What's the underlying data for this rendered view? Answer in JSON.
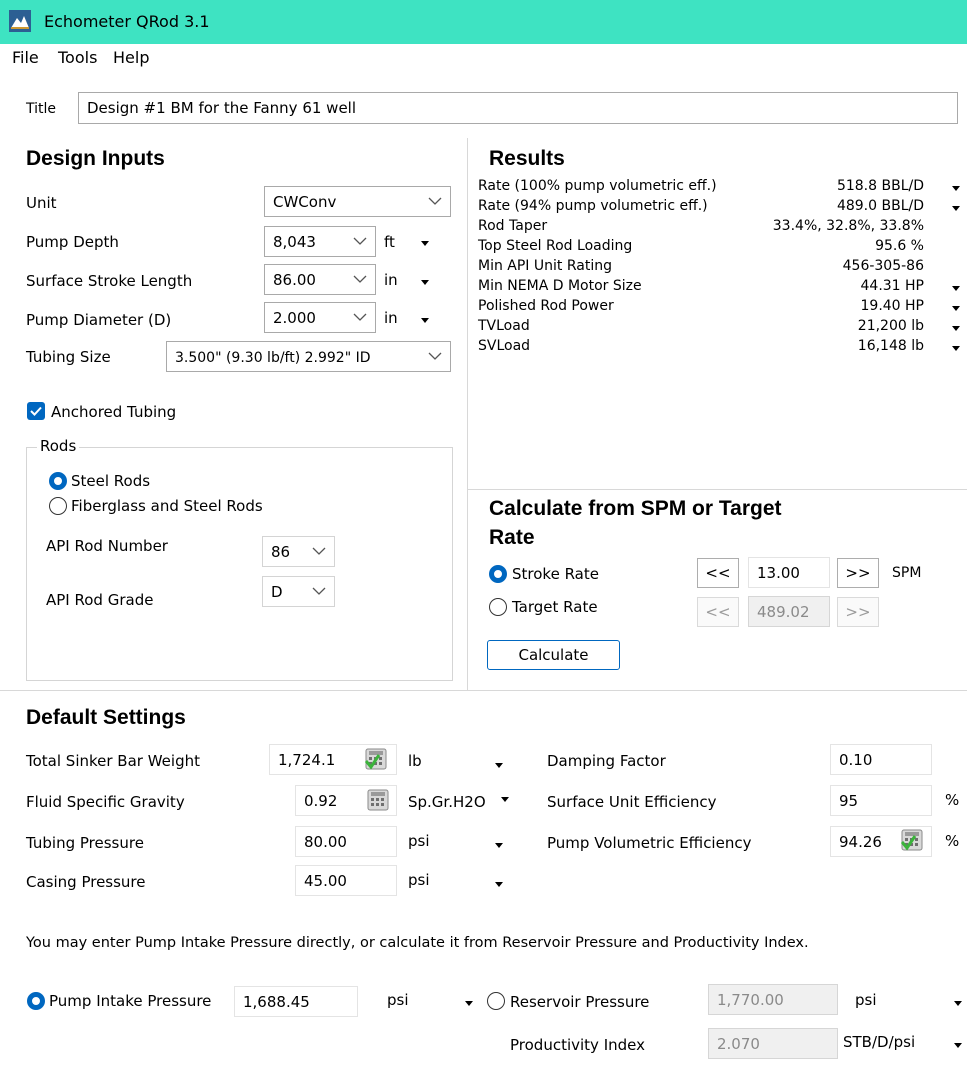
{
  "window": {
    "title": "Echometer QRod 3.1"
  },
  "menu": [
    "File",
    "Tools",
    "Help"
  ],
  "title_field": {
    "label": "Title",
    "value": "Design #1 BM for the Fanny 61 well"
  },
  "design_inputs": {
    "heading": "Design Inputs",
    "unit": {
      "label": "Unit",
      "value": "CWConv"
    },
    "pump_depth": {
      "label": "Pump Depth",
      "value": "8,043",
      "unit": "ft"
    },
    "stroke_length": {
      "label": "Surface Stroke Length",
      "value": "86.00",
      "unit": "in"
    },
    "pump_diameter": {
      "label": "Pump Diameter (D)",
      "value": "2.000",
      "unit": "in"
    },
    "tubing_size": {
      "label": "Tubing Size",
      "value": "3.500\" (9.30 lb/ft) 2.992\" ID"
    },
    "anchored_tubing": {
      "label": "Anchored Tubing",
      "checked": true
    },
    "rods": {
      "group_label": "Rods",
      "steel": "Steel Rods",
      "fiberglass": "Fiberglass and Steel Rods",
      "selected": "steel",
      "api_rod_number": {
        "label": "API Rod Number",
        "value": "86"
      },
      "api_rod_grade": {
        "label": "API Rod Grade",
        "value": "D"
      }
    }
  },
  "results": {
    "heading": "Results",
    "rows": [
      {
        "label": "Rate (100% pump volumetric eff.)",
        "value": "518.8 BBL/D",
        "dropdown": true
      },
      {
        "label": "Rate (94% pump volumetric eff.)",
        "value": "489.0 BBL/D",
        "dropdown": true
      },
      {
        "label": "Rod Taper",
        "value": "33.4%, 32.8%, 33.8%",
        "dropdown": false
      },
      {
        "label": "Top Steel Rod Loading",
        "value": "95.6 %",
        "dropdown": false
      },
      {
        "label": "Min API Unit Rating",
        "value": "456-305-86",
        "dropdown": false
      },
      {
        "label": "Min NEMA D Motor Size",
        "value": "44.31 HP",
        "dropdown": true
      },
      {
        "label": "Polished Rod Power",
        "value": "19.40 HP",
        "dropdown": true
      },
      {
        "label": "TVLoad",
        "value": "21,200 lb",
        "dropdown": true
      },
      {
        "label": "SVLoad",
        "value": "16,148 lb",
        "dropdown": true
      }
    ]
  },
  "calculate": {
    "heading_line1": "Calculate from SPM or Target",
    "heading_line2": "Rate",
    "stroke_rate": {
      "label": "Stroke Rate",
      "value": "13.00",
      "unit": "SPM"
    },
    "target_rate": {
      "label": "Target Rate",
      "value": "489.02"
    },
    "selected": "stroke_rate",
    "dec_label": "<<",
    "inc_label": ">>",
    "button": "Calculate"
  },
  "defaults": {
    "heading": "Default Settings",
    "sinker_bar": {
      "label": "Total Sinker Bar Weight",
      "value": "1,724.1",
      "unit": "lb"
    },
    "fluid_sg": {
      "label": "Fluid Specific Gravity",
      "value": "0.92",
      "unit": "Sp.Gr.H2O"
    },
    "tubing_pressure": {
      "label": "Tubing Pressure",
      "value": "80.00",
      "unit": "psi"
    },
    "casing_pressure": {
      "label": "Casing Pressure",
      "value": "45.00",
      "unit": "psi"
    },
    "damping": {
      "label": "Damping Factor",
      "value": "0.10"
    },
    "surface_eff": {
      "label": "Surface Unit Efficiency",
      "value": "95",
      "unit": "%"
    },
    "pump_vol_eff": {
      "label": "Pump Volumetric Efficiency",
      "value": "94.26",
      "unit": "%"
    }
  },
  "intake": {
    "note": "You may enter Pump Intake Pressure directly, or calculate it from Reservoir Pressure and Productivity Index.",
    "pip": {
      "label": "Pump Intake Pressure",
      "value": "1,688.45",
      "unit": "psi"
    },
    "reservoir": {
      "label": "Reservoir Pressure",
      "value": "1,770.00",
      "unit": "psi"
    },
    "pi": {
      "label": "Productivity Index",
      "value": "2.070",
      "unit": "STB/D/psi"
    },
    "selected": "pip"
  },
  "colors": {
    "titlebar": "#3ee3c2",
    "accent": "#0067c0",
    "check_green": "#3bb33b"
  }
}
